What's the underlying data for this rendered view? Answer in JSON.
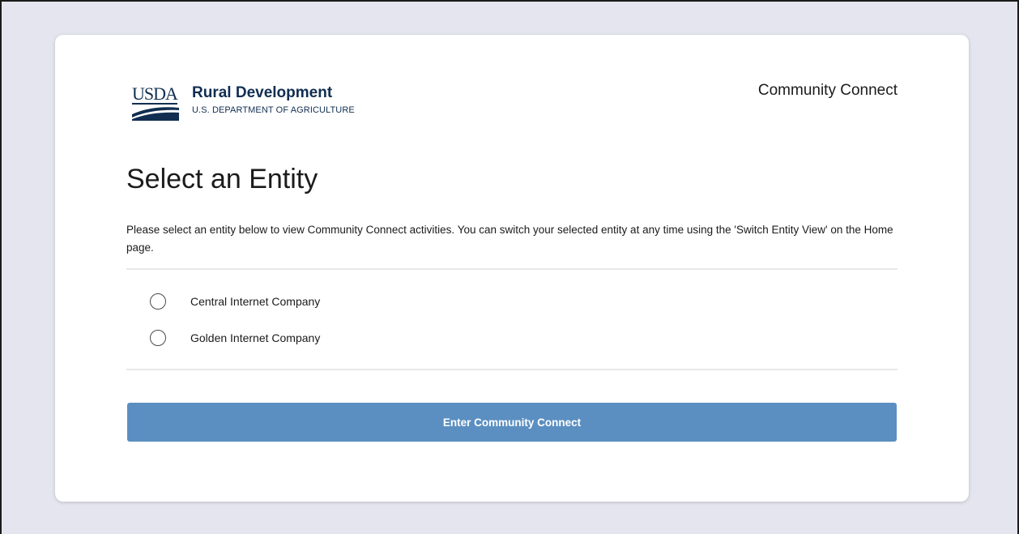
{
  "header": {
    "logo_agency": "USDA",
    "logo_name": "Rural Development",
    "logo_subtitle": "U.S. DEPARTMENT OF AGRICULTURE",
    "app_name": "Community Connect"
  },
  "main": {
    "title": "Select an Entity",
    "instructions": "Please select an entity below to view Community Connect activities. You can switch your selected entity at any time using the 'Switch Entity View' on the Home page.",
    "entities": [
      {
        "label": "Central Internet Company",
        "selected": false
      },
      {
        "label": "Golden Internet Company",
        "selected": false
      }
    ],
    "enter_button_label": "Enter Community Connect"
  },
  "colors": {
    "background": "#e4e5ee",
    "card": "#ffffff",
    "brand_navy": "#112e51",
    "button": "#5b8fc1",
    "divider": "#e8e8e8"
  }
}
